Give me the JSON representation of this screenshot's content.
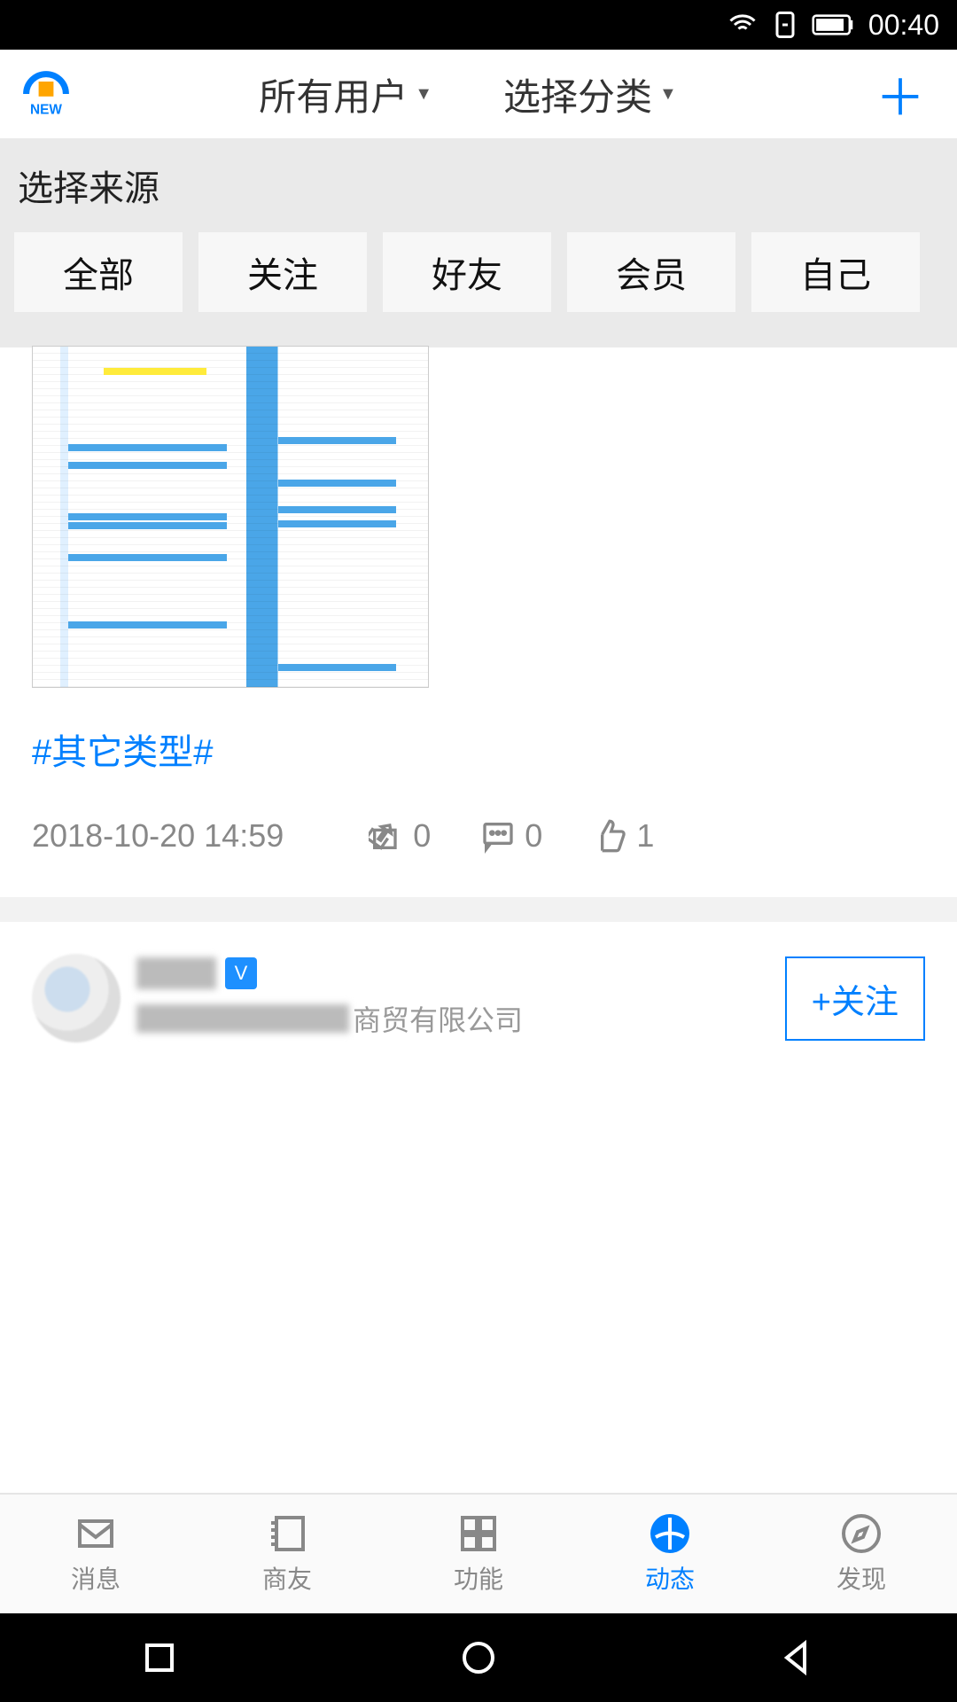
{
  "status": {
    "time": "00:40"
  },
  "header": {
    "dropdown1": "所有用户",
    "dropdown2": "选择分类"
  },
  "filter": {
    "title": "选择来源",
    "chips": [
      "全部",
      "关注",
      "好友",
      "会员",
      "自己"
    ]
  },
  "post1": {
    "tag": "#其它类型#",
    "date": "2018-10-20  14:59",
    "share_count": "0",
    "comment_count": "0",
    "like_count": "1"
  },
  "post2": {
    "company_suffix": "商贸有限公司",
    "follow_label": "+关注"
  },
  "nav": {
    "items": [
      {
        "label": "消息"
      },
      {
        "label": "商友"
      },
      {
        "label": "功能"
      },
      {
        "label": "动态"
      },
      {
        "label": "发现"
      }
    ],
    "active_index": 3
  }
}
